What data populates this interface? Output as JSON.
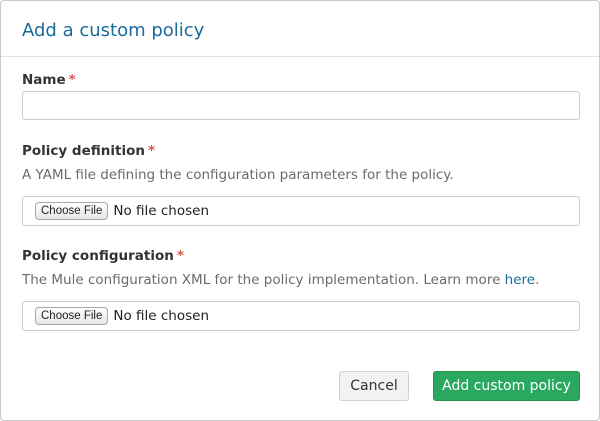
{
  "dialog": {
    "title": "Add a custom policy"
  },
  "form": {
    "name": {
      "label": "Name",
      "required_marker": "*",
      "value": ""
    },
    "policy_definition": {
      "label": "Policy definition",
      "required_marker": "*",
      "help": "A YAML file defining the configuration parameters for the policy.",
      "choose_label": "Choose File",
      "file_status": "No file chosen"
    },
    "policy_configuration": {
      "label": "Policy configuration",
      "required_marker": "*",
      "help": "The Mule configuration XML for the policy implementation. Learn more ",
      "help_link": "here",
      "help_suffix": ".",
      "choose_label": "Choose File",
      "file_status": "No file chosen"
    }
  },
  "actions": {
    "cancel_label": "Cancel",
    "submit_label": "Add custom policy"
  },
  "colors": {
    "title": "#1a6a9a",
    "required": "#d9534f",
    "primary": "#2aa860",
    "link": "#1a6a9a"
  }
}
